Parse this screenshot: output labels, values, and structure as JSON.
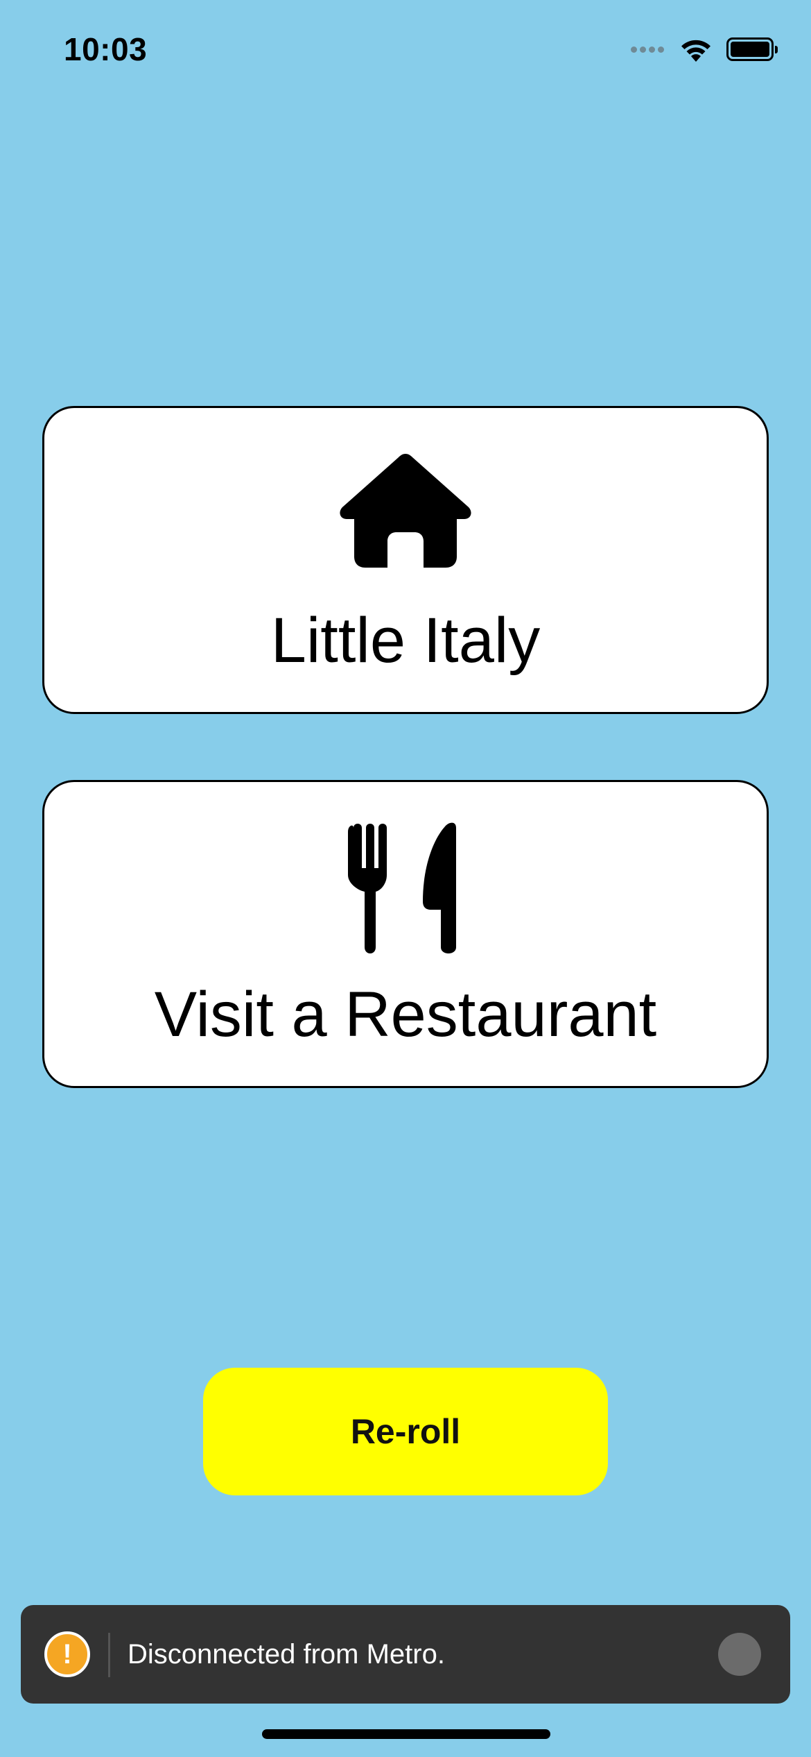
{
  "status_bar": {
    "time": "10:03"
  },
  "cards": [
    {
      "label": "Little Italy",
      "icon": "house-icon"
    },
    {
      "label": "Visit a Restaurant",
      "icon": "fork-knife-icon"
    }
  ],
  "reroll_button": {
    "label": "Re-roll"
  },
  "toast": {
    "message": "Disconnected from Metro.",
    "icon_symbol": "!"
  },
  "colors": {
    "background": "#87cdea",
    "card_background": "#ffffff",
    "button": "#ffff00",
    "toast_background": "#333333",
    "warning": "#f5a623"
  }
}
